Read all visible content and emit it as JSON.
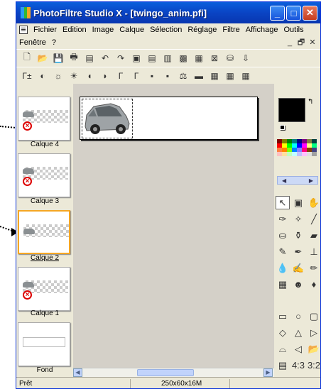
{
  "window": {
    "title": "PhotoFiltre Studio X - [twingo_anim.pfi]",
    "title_buttons": [
      "_",
      "□",
      "✕"
    ]
  },
  "menu": {
    "row1": [
      "Fichier",
      "Edition",
      "Image",
      "Calque",
      "Sélection",
      "Réglage",
      "Filtre",
      "Affichage",
      "Outils"
    ],
    "row2": [
      "Fenêtre",
      "?"
    ],
    "mdi_controls": [
      "_",
      "🗗",
      "✕"
    ]
  },
  "toolbar1": [
    {
      "icon": "new-file-icon",
      "glyph": "🗋"
    },
    {
      "icon": "open-folder-icon",
      "glyph": "📂"
    },
    {
      "icon": "save-icon",
      "glyph": "💾"
    },
    {
      "icon": "print-icon",
      "glyph": "🖶"
    },
    {
      "icon": "scan-icon",
      "glyph": "▤"
    },
    {
      "icon": "undo-icon",
      "glyph": "↶"
    },
    {
      "icon": "redo-icon",
      "glyph": "↷"
    },
    {
      "icon": "layer-copy-icon",
      "glyph": "▣"
    },
    {
      "icon": "layer-paste-icon",
      "glyph": "▤"
    },
    {
      "icon": "layer-merge-icon",
      "glyph": "▥"
    },
    {
      "icon": "shade-icon",
      "glyph": "▩"
    },
    {
      "icon": "color-grid-icon",
      "glyph": "▦"
    },
    {
      "icon": "frame-icon",
      "glyph": "⊠"
    },
    {
      "icon": "stamp-icon",
      "glyph": "⛁"
    },
    {
      "icon": "export-icon",
      "glyph": "⇩"
    }
  ],
  "toolbar2": [
    {
      "icon": "auto-levels-icon",
      "glyph": "Γ±"
    },
    {
      "icon": "auto-contrast-icon",
      "glyph": "◐"
    },
    {
      "icon": "brightness-minus-icon",
      "glyph": "☼"
    },
    {
      "icon": "brightness-plus-icon",
      "glyph": "☀"
    },
    {
      "icon": "contrast-minus-icon",
      "glyph": "◖"
    },
    {
      "icon": "contrast-plus-icon",
      "glyph": "◗"
    },
    {
      "icon": "gamma-minus-icon",
      "glyph": "Γ"
    },
    {
      "icon": "gamma-plus-icon",
      "glyph": "Γ"
    },
    {
      "icon": "saturation-minus-icon",
      "glyph": "▪"
    },
    {
      "icon": "saturation-plus-icon",
      "glyph": "▪"
    },
    {
      "icon": "color-balance-icon",
      "glyph": "⚖"
    },
    {
      "icon": "hue-icon",
      "glyph": "▬"
    },
    {
      "icon": "filter-a-icon",
      "glyph": "▦"
    },
    {
      "icon": "filter-b-icon",
      "glyph": "▦"
    },
    {
      "icon": "filter-c-icon",
      "glyph": "▦"
    }
  ],
  "layers": [
    {
      "label": "Calque 4",
      "selected": false
    },
    {
      "label": "Calque 3",
      "selected": false
    },
    {
      "label": "Calque 2",
      "selected": true
    },
    {
      "label": "Calque 1",
      "selected": false
    },
    {
      "label": "Fond",
      "selected": false
    }
  ],
  "colors": {
    "foreground": "#000000",
    "background": "#ffffff",
    "accent_selected_layer": "#f5a623",
    "titlebar": "#0a44c4"
  },
  "palette": [
    "#800000",
    "#808000",
    "#008000",
    "#008080",
    "#000080",
    "#800080",
    "#808040",
    "#004040",
    "#ff0000",
    "#ffff00",
    "#00ff00",
    "#00ffff",
    "#0000ff",
    "#ff00ff",
    "#ffff80",
    "#00ff80",
    "#ff8040",
    "#ff8000",
    "#80ff00",
    "#0080ff",
    "#8080ff",
    "#ff0080",
    "#804000",
    "#404080",
    "#ffc0c0",
    "#ffe0a0",
    "#c0ffc0",
    "#c0ffff",
    "#c0c0ff",
    "#ffc0ff",
    "#e0e0e0",
    "#a0a0a0"
  ],
  "palette_nav": [
    "◀",
    "▶"
  ],
  "color_swap_glyph": "↰",
  "tools": [
    {
      "icon": "pointer-icon",
      "glyph": "↖",
      "active": true
    },
    {
      "icon": "selection-icon",
      "glyph": "▣",
      "active": false
    },
    {
      "icon": "hand-icon",
      "glyph": "✋",
      "active": false
    },
    {
      "icon": "eyedropper-icon",
      "glyph": "✑",
      "active": false
    },
    {
      "icon": "magic-wand-icon",
      "glyph": "✧",
      "active": false
    },
    {
      "icon": "line-icon",
      "glyph": "╱",
      "active": false
    },
    {
      "icon": "fill-bucket-icon",
      "glyph": "⛀",
      "active": false
    },
    {
      "icon": "spray-icon",
      "glyph": "⚱",
      "active": false
    },
    {
      "icon": "eraser-icon",
      "glyph": "▰",
      "active": false
    },
    {
      "icon": "brush-icon",
      "glyph": "✎",
      "active": false
    },
    {
      "icon": "advanced-brush-icon",
      "glyph": "✒",
      "active": false
    },
    {
      "icon": "stamp-tool-icon",
      "glyph": "⊥",
      "active": false
    },
    {
      "icon": "blur-icon",
      "glyph": "💧",
      "active": false
    },
    {
      "icon": "smudge-icon",
      "glyph": "✍",
      "active": false
    },
    {
      "icon": "clone-icon",
      "glyph": "✏",
      "active": false
    },
    {
      "icon": "pattern-icon",
      "glyph": "▦",
      "active": false
    },
    {
      "icon": "portrait-icon",
      "glyph": "☻",
      "active": false
    },
    {
      "icon": "strawberry-icon",
      "glyph": "♦",
      "active": false
    }
  ],
  "shapes": [
    {
      "icon": "rectangle-icon",
      "glyph": "▭"
    },
    {
      "icon": "ellipse-icon",
      "glyph": "○"
    },
    {
      "icon": "rounded-rect-icon",
      "glyph": "▢"
    },
    {
      "icon": "diamond-icon",
      "glyph": "◇"
    },
    {
      "icon": "triangle-up-icon",
      "glyph": "△"
    },
    {
      "icon": "triangle-right-icon",
      "glyph": "▷"
    },
    {
      "icon": "lasso-icon",
      "glyph": "⌓"
    },
    {
      "icon": "polygon-icon",
      "glyph": "◁"
    },
    {
      "icon": "open-shape-icon",
      "glyph": "📂"
    },
    {
      "icon": "layout-a-icon",
      "glyph": "▤"
    },
    {
      "icon": "layout-b-icon",
      "glyph": "4:3"
    },
    {
      "icon": "layout-c-icon",
      "glyph": "3:2"
    }
  ],
  "scroll": {
    "left": "◀",
    "right": "▶",
    "thumb": "|||"
  },
  "status": {
    "left": "Prêt",
    "dimensions": "250x60x16M"
  }
}
